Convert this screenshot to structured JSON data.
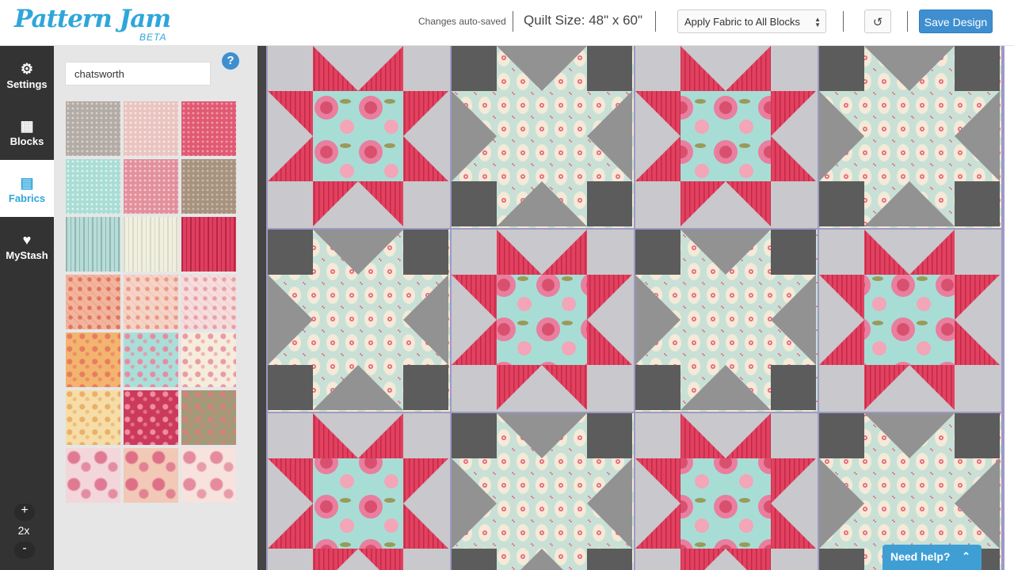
{
  "header": {
    "logo": "Pattern Jam",
    "logo_badge": "BETA",
    "autosave_status": "Changes auto-saved",
    "quilt_size": "Quilt Size: 48\" x 60\"",
    "apply_select": "Apply Fabric to All Blocks",
    "undo_icon": "undo-icon",
    "save_label": "Save Design"
  },
  "nav": {
    "items": [
      {
        "label": "Settings",
        "icon": "gear-icon",
        "glyph": "⚙"
      },
      {
        "label": "Blocks",
        "icon": "grid-icon",
        "glyph": "▦"
      },
      {
        "label": "Fabrics",
        "icon": "film-icon",
        "glyph": "▤"
      },
      {
        "label": "MyStash",
        "icon": "heart-icon",
        "glyph": "♥"
      }
    ],
    "active": "Fabrics",
    "zoom_in": "+",
    "zoom_level": "2x",
    "zoom_out": "-"
  },
  "fabrics": {
    "search_value": "chatsworth",
    "help_label": "?",
    "swatches": [
      {
        "name": "gray-dot",
        "bg": "#b3aca6",
        "fg": "#d7d2cc",
        "type": "dots"
      },
      {
        "name": "pink-dot",
        "bg": "#e9c4c0",
        "fg": "#f7e6e3",
        "type": "dots"
      },
      {
        "name": "red-dot",
        "bg": "#e05a73",
        "fg": "#f29cab",
        "type": "dots"
      },
      {
        "name": "mint-dot",
        "bg": "#a9ddd6",
        "fg": "#dff2ee",
        "type": "dots"
      },
      {
        "name": "rose-dot",
        "bg": "#e2909c",
        "fg": "#f4c9cf",
        "type": "dots"
      },
      {
        "name": "taupe-dot",
        "bg": "#a7927f",
        "fg": "#cbbba9",
        "type": "dots"
      },
      {
        "name": "aqua-stripe",
        "bg": "#b8dcd8",
        "fg": "#8fb8b2",
        "type": "stripe"
      },
      {
        "name": "cream-stripe",
        "bg": "#f0efe0",
        "fg": "#d8dbc6",
        "type": "stripe"
      },
      {
        "name": "red-stripe",
        "bg": "#df3f62",
        "fg": "#b8263f",
        "type": "stripe"
      },
      {
        "name": "peach-lattice",
        "bg": "#f2b49d",
        "fg": "#e0765f",
        "type": "lattice"
      },
      {
        "name": "salmon-lattice",
        "bg": "#f5d3c6",
        "fg": "#e89a86",
        "type": "lattice"
      },
      {
        "name": "pink-lattice",
        "bg": "#f6dcdc",
        "fg": "#e7a2a7",
        "type": "lattice"
      },
      {
        "name": "orange-floral",
        "bg": "#f2b46e",
        "fg": "#e87c61",
        "type": "floral"
      },
      {
        "name": "aqua-floral",
        "bg": "#a9dfd8",
        "fg": "#ea8aa0",
        "type": "floral"
      },
      {
        "name": "cream-floral",
        "bg": "#f6ecdc",
        "fg": "#e99aa9",
        "type": "floral"
      },
      {
        "name": "yellow-paisley",
        "bg": "#f6dca6",
        "fg": "#eab067",
        "type": "floral"
      },
      {
        "name": "magenta-paisley",
        "bg": "#cc3a5b",
        "fg": "#ef8da2",
        "type": "floral"
      },
      {
        "name": "khaki-paisley",
        "bg": "#a39a77",
        "fg": "#d97f80",
        "type": "floral"
      },
      {
        "name": "rose-large",
        "bg": "#f3d6da",
        "fg": "#e07a92",
        "type": "rose"
      },
      {
        "name": "peach-large",
        "bg": "#f2c8b7",
        "fg": "#de6f87",
        "type": "rose"
      },
      {
        "name": "blush-large",
        "bg": "#f7e2de",
        "fg": "#e58b9e",
        "type": "rose"
      }
    ]
  },
  "quilt": {
    "colors": {
      "light_gray": "#c9c8cc",
      "dark_gray": "#5c5c5c",
      "mid_gray": "#929292",
      "star_red": "#e2415f",
      "star_red_dark": "#c3294a",
      "floral_bg": "#a8ddd6",
      "floral_rose": "#e97e9e",
      "tile_bg": "#c9e0d6",
      "tile_motif": "#f4ead7",
      "tile_accent": "#e8677f",
      "seam": "#9d9ac6"
    },
    "layout": [
      [
        "star",
        "diamond",
        "star",
        "diamond"
      ],
      [
        "diamond",
        "star",
        "diamond",
        "star"
      ],
      [
        "star",
        "diamond",
        "star",
        "diamond"
      ]
    ]
  },
  "help_widget": {
    "label": "Need help?",
    "icon": "chevron-up-icon"
  }
}
